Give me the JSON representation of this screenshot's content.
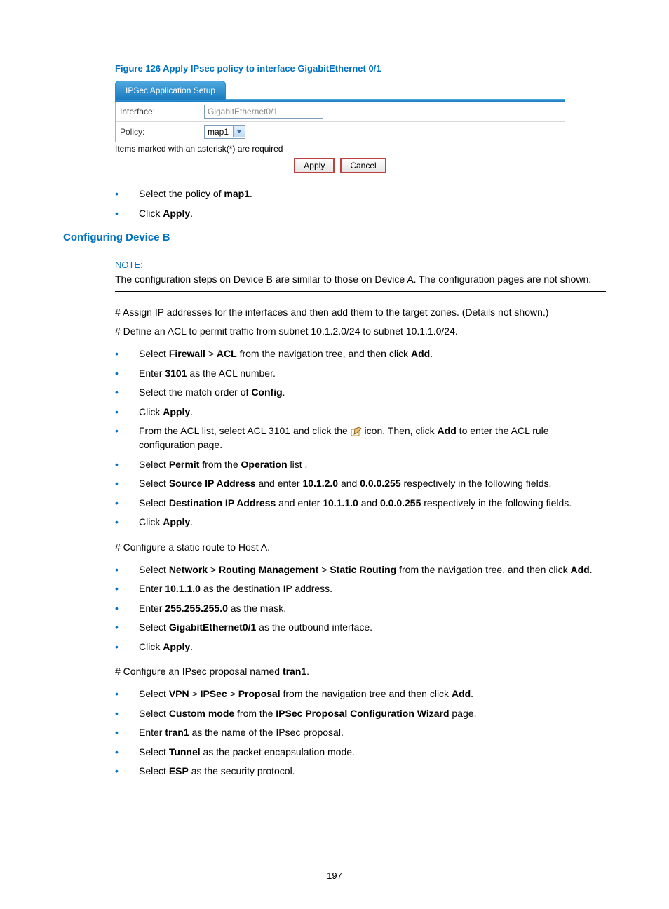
{
  "figure_caption": "Figure 126 Apply IPsec policy to interface GigabitEthernet 0/1",
  "tab_label": "IPSec Application Setup",
  "form": {
    "interface_label": "Interface:",
    "interface_value": "GigabitEthernet0/1",
    "policy_label": "Policy:",
    "policy_value": "map1",
    "asterisk_note": "Items marked with an asterisk(*) are required",
    "apply_btn": "Apply",
    "cancel_btn": "Cancel"
  },
  "list_a": {
    "i0_a": "Select the policy of ",
    "i0_b": "map1",
    "i0_c": ".",
    "i1_a": "Click ",
    "i1_b": "Apply",
    "i1_c": "."
  },
  "section_heading": "Configuring Device B",
  "note": {
    "title": "NOTE:",
    "text": "The configuration steps on Device B are similar to those on Device A. The configuration pages are not shown."
  },
  "p1": "# Assign IP addresses for the interfaces and then add them to the target zones. (Details not shown.)",
  "p2": "# Define an ACL to permit traffic from subnet 10.1.2.0/24 to subnet 10.1.1.0/24.",
  "list_b": {
    "i0_a": "Select ",
    "i0_b": "Firewall",
    "i0_c": " > ",
    "i0_d": "ACL",
    "i0_e": " from the navigation tree, and then click ",
    "i0_f": "Add",
    "i0_g": ".",
    "i1_a": "Enter ",
    "i1_b": "3101",
    "i1_c": " as the ACL number.",
    "i2_a": "Select the match order of ",
    "i2_b": "Config",
    "i2_c": ".",
    "i3_a": "Click ",
    "i3_b": "Apply",
    "i3_c": ".",
    "i4_a": "From the ACL list, select ACL 3101 and click the ",
    "i4_b": " icon. Then, click ",
    "i4_c": "Add",
    "i4_d": " to enter the ACL rule configuration page.",
    "i5_a": "Select ",
    "i5_b": "Permit",
    "i5_c": " from the ",
    "i5_d": "Operation",
    "i5_e": " list .",
    "i6_a": "Select ",
    "i6_b": "Source IP Address",
    "i6_c": " and enter ",
    "i6_d": "10.1.2.0",
    "i6_e": " and ",
    "i6_f": "0.0.0.255",
    "i6_g": " respectively in the following fields.",
    "i7_a": "Select ",
    "i7_b": "Destination IP Address",
    "i7_c": " and enter ",
    "i7_d": "10.1.1.0",
    "i7_e": " and ",
    "i7_f": "0.0.0.255",
    "i7_g": " respectively in the following fields.",
    "i8_a": "Click ",
    "i8_b": "Apply",
    "i8_c": "."
  },
  "p3": "# Configure a static route to Host A.",
  "list_c": {
    "i0_a": "Select ",
    "i0_b": "Network",
    "i0_c": " > ",
    "i0_d": "Routing Management",
    "i0_e": " > ",
    "i0_f": "Static Routing",
    "i0_g": " from the navigation tree, and then click ",
    "i0_h": "Add",
    "i0_i": ".",
    "i1_a": "Enter ",
    "i1_b": "10.1.1.0",
    "i1_c": " as the destination IP address.",
    "i2_a": "Enter ",
    "i2_b": "255.255.255.0",
    "i2_c": " as the mask.",
    "i3_a": "Select ",
    "i3_b": "GigabitEthernet0/1",
    "i3_c": " as the outbound interface.",
    "i4_a": "Click ",
    "i4_b": "Apply",
    "i4_c": "."
  },
  "p4_a": "# Configure an IPsec proposal named ",
  "p4_b": "tran1",
  "p4_c": ".",
  "list_d": {
    "i0_a": "Select ",
    "i0_b": "VPN",
    "i0_c": " > ",
    "i0_d": "IPSec",
    "i0_e": " > ",
    "i0_f": "Proposal",
    "i0_g": " from the navigation tree and then click ",
    "i0_h": "Add",
    "i0_i": ".",
    "i1_a": "Select ",
    "i1_b": "Custom mode",
    "i1_c": " from the ",
    "i1_d": "IPSec Proposal Configuration Wizard",
    "i1_e": " page.",
    "i2_a": "Enter ",
    "i2_b": "tran1",
    "i2_c": " as the name of the IPsec proposal.",
    "i3_a": "Select ",
    "i3_b": "Tunnel",
    "i3_c": " as the packet encapsulation mode.",
    "i4_a": "Select ",
    "i4_b": "ESP",
    "i4_c": " as the security protocol."
  },
  "page_number": "197"
}
